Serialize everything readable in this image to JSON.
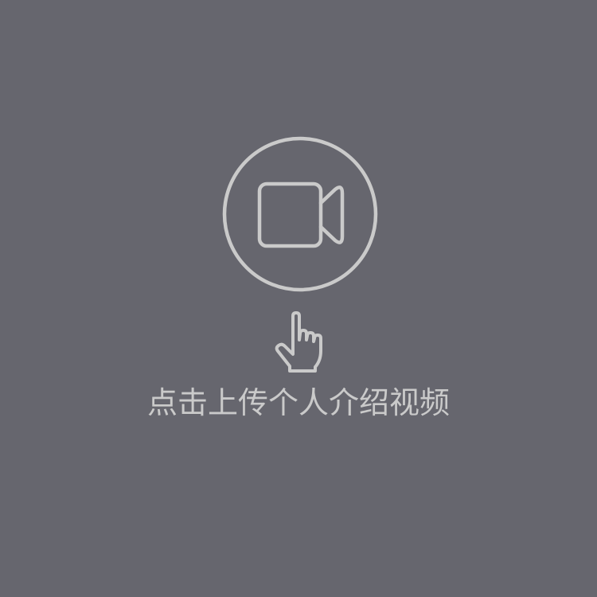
{
  "upload": {
    "label": "点击上传个人介绍视频",
    "icon": "video-camera-icon",
    "pointer_icon": "hand-pointer-icon"
  },
  "colors": {
    "background": "#66666e",
    "foreground": "#cacaca"
  }
}
